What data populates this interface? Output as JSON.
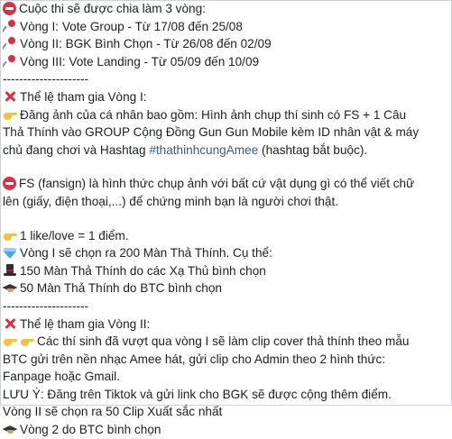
{
  "post": {
    "lines": [
      {
        "icon": "no-entry-icon",
        "text": "Cuộc thi sẽ được chia làm 3 vòng:"
      },
      {
        "icon": "round-pushpin-icon",
        "text": "Vòng I: Vote Group - Từ 17/08 đến 25/08"
      },
      {
        "icon": "round-pushpin-icon",
        "text": "Vòng II: BGK Bình Chọn - Từ 26/08 đến 02/09"
      },
      {
        "icon": "round-pushpin-icon",
        "text": "Vòng III: Vote Landing - Từ 05/09 đến 10/09"
      },
      {
        "icon": "",
        "text": "---------------------"
      },
      {
        "icon": "red-x-icon",
        "text": "Thể lệ tham gia Vòng I:"
      },
      {
        "icon": "pointing-hand-icon",
        "text": "Đăng ảnh của cá nhân bao gồm: Hình ảnh chụp thí sinh có FS + 1 Câu"
      },
      {
        "icon": "",
        "text": "Thả Thính vào GROUP Cộng Đồng Gun Gun Mobile kèm ID nhân vật & máy"
      },
      {
        "icon": "",
        "text": "chủ đang chơi và Hashtag ",
        "hashtag": "#thathinhcungAmee",
        "after": " (hashtag bắt buộc)."
      },
      {
        "icon": "",
        "text": ""
      },
      {
        "icon": "no-entry-icon",
        "text": "FS (fansign) là hình thức chụp ảnh với bất cứ vật dụng gì có thể viết chữ"
      },
      {
        "icon": "",
        "text": "lên (giấy, điện thoại,...) để chứng minh bạn là người chơi thật."
      },
      {
        "icon": "",
        "text": ""
      },
      {
        "icon": "pointing-hand-icon",
        "text": "1 like/love = 1 điểm."
      },
      {
        "icon": "diamond-icon",
        "text": "Vòng I sẽ chọn ra 200 Màn Thả Thính. Cụ thể:"
      },
      {
        "icon": "top-hat-icon",
        "text": "150 Màn Thả Thính do các Xạ Thủ bình chọn"
      },
      {
        "icon": "graduation-cap-icon",
        "text": "50 Màn Thả Thính do BTC bình chọn"
      },
      {
        "icon": "",
        "text": "---------------------"
      },
      {
        "icon": "red-x-icon",
        "text": "Thể lệ tham gia Vòng II:"
      },
      {
        "icon": "pointing-hand-icon-x2",
        "text": "Các thí sinh đã vượt qua vòng I sẽ làm clip cover thả thính theo mẫu"
      },
      {
        "icon": "",
        "text": "BTC gửi trên nền nhạc Amee hát, gửi clip cho Admin theo 2 hình thức:"
      },
      {
        "icon": "",
        "text": "Fanpage hoặc Gmail."
      },
      {
        "icon": "",
        "text": "LƯU Ý: Đăng trên Tiktok và gửi link cho BGK sẽ được cộng thêm điểm."
      },
      {
        "icon": "",
        "text": "Vòng II sẽ chọn ra 50 Clip Xuất sắc nhất"
      },
      {
        "icon": "graduation-cap-icon",
        "text": "Vòng 2 do BTC bình chọn"
      }
    ]
  }
}
